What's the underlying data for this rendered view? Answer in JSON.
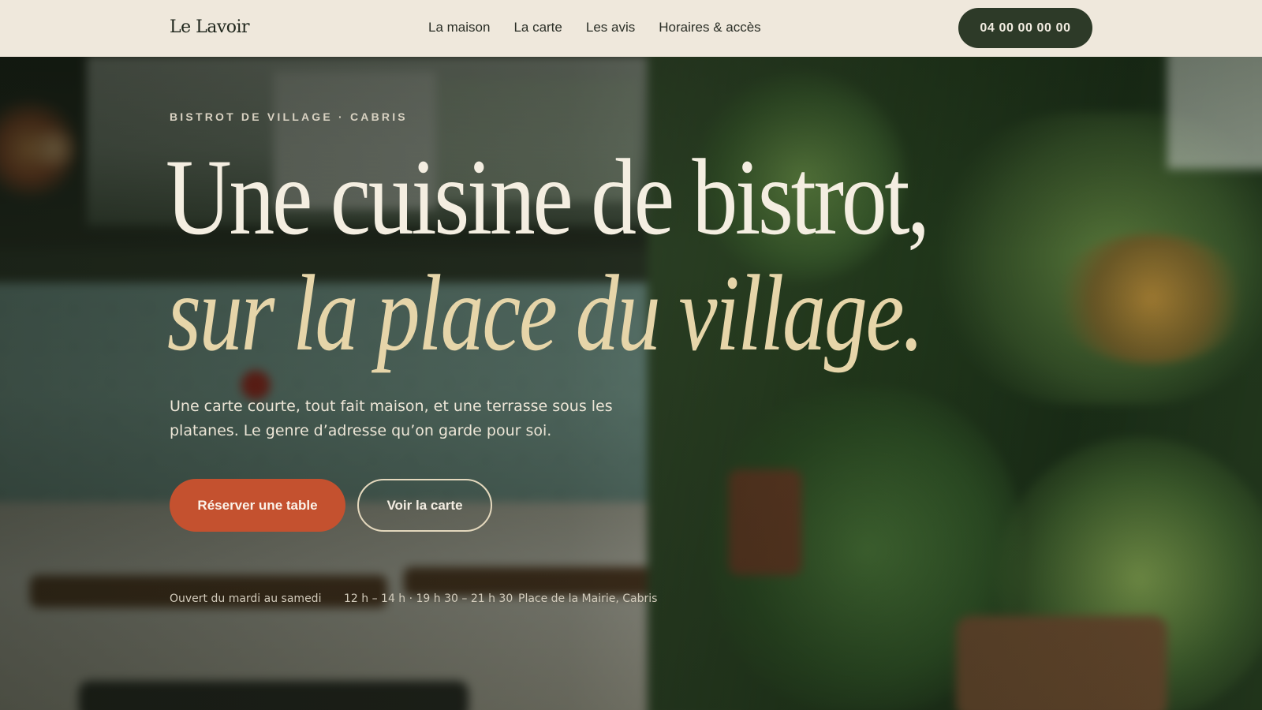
{
  "header": {
    "brand": "Le Lavoir",
    "nav": [
      "La maison",
      "La carte",
      "Les avis",
      "Horaires & accès"
    ],
    "phone": "04 00 00 00 00"
  },
  "hero": {
    "eyebrow": "BISTROT DE VILLAGE · CABRIS",
    "headline_line1": "Une cuisine de bistrot,",
    "headline_line2": "sur la place du village.",
    "lede": "Une carte courte, tout fait maison, et une terrasse sous les platanes. Le genre d’adresse qu’on garde pour soi.",
    "primary_cta": "Réserver une table",
    "secondary_cta": "Voir la carte",
    "info": {
      "days": "Ouvert du mardi au samedi",
      "hours": "12 h – 14 h · 19 h 30 – 21 h 30",
      "place": "Place de la Mairie, Cabris"
    }
  },
  "colors": {
    "header_bg": "#efe8dc",
    "phone_bg": "#2d3a28",
    "primary_cta": "#c4512f",
    "headline_line2": "#e6d5a9"
  }
}
